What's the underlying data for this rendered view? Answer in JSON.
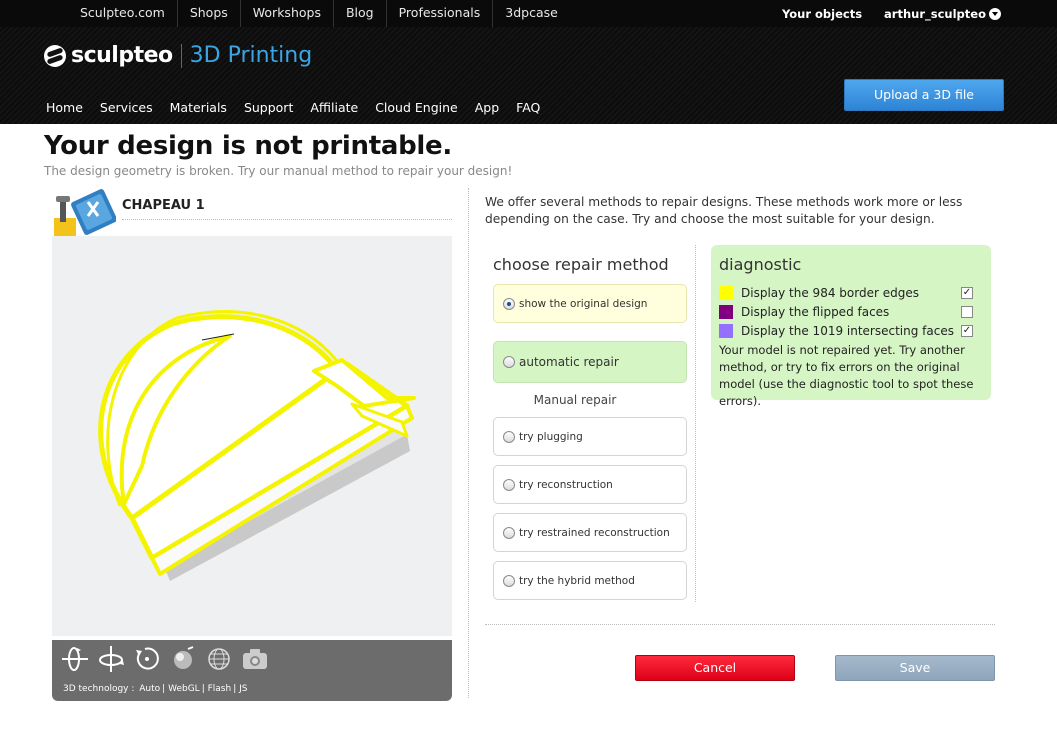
{
  "topbar": {
    "links": [
      "Sculpteo.com",
      "Shops",
      "Workshops",
      "Blog",
      "Professionals",
      "3dpcase"
    ],
    "your_objects": "Your objects",
    "username": "arthur_sculpteo"
  },
  "header": {
    "logo_text": "sculpteo",
    "logo_sub": "3D Printing",
    "nav": [
      "Home",
      "Services",
      "Materials",
      "Support",
      "Affiliate",
      "Cloud Engine",
      "App",
      "FAQ"
    ],
    "upload_label": "Upload a 3D file"
  },
  "page": {
    "title": "Your design is not printable.",
    "subtitle": "The design geometry is broken. Try our manual method to repair your design!"
  },
  "design": {
    "name": "CHAPEAU 1"
  },
  "viewer": {
    "tech_label": "3D technology :",
    "tech_options": [
      "Auto",
      "WebGL",
      "Flash",
      "JS"
    ],
    "tools": [
      "rotate-x-icon",
      "rotate-y-icon",
      "rotate-z-icon",
      "render-icon",
      "wireframe-icon",
      "snapshot-icon"
    ]
  },
  "repair": {
    "intro": "We offer several methods to repair designs. These methods work more or less depending on the case. Try and choose the most suitable for your design.",
    "choose_title": "choose repair method",
    "original": "show the original design",
    "automatic": "automatic repair",
    "manual_label": "Manual repair",
    "manual_options": [
      "try plugging",
      "try reconstruction",
      "try restrained reconstruction",
      "try the hybrid method"
    ],
    "selected": "show the original design"
  },
  "diagnostic": {
    "title": "diagnostic",
    "items": [
      {
        "label": "Display the 984 border edges",
        "color": "#ffff00",
        "checked": true
      },
      {
        "label": "Display the flipped faces",
        "color": "#800080",
        "checked": false
      },
      {
        "label": "Display the 1019 intersecting faces",
        "color": "#9370ff",
        "checked": true
      }
    ],
    "note": "Your model is not repaired yet. Try another method, or try to fix errors on the original model (use the diagnostic tool to spot these errors)."
  },
  "actions": {
    "cancel": "Cancel",
    "save": "Save"
  }
}
